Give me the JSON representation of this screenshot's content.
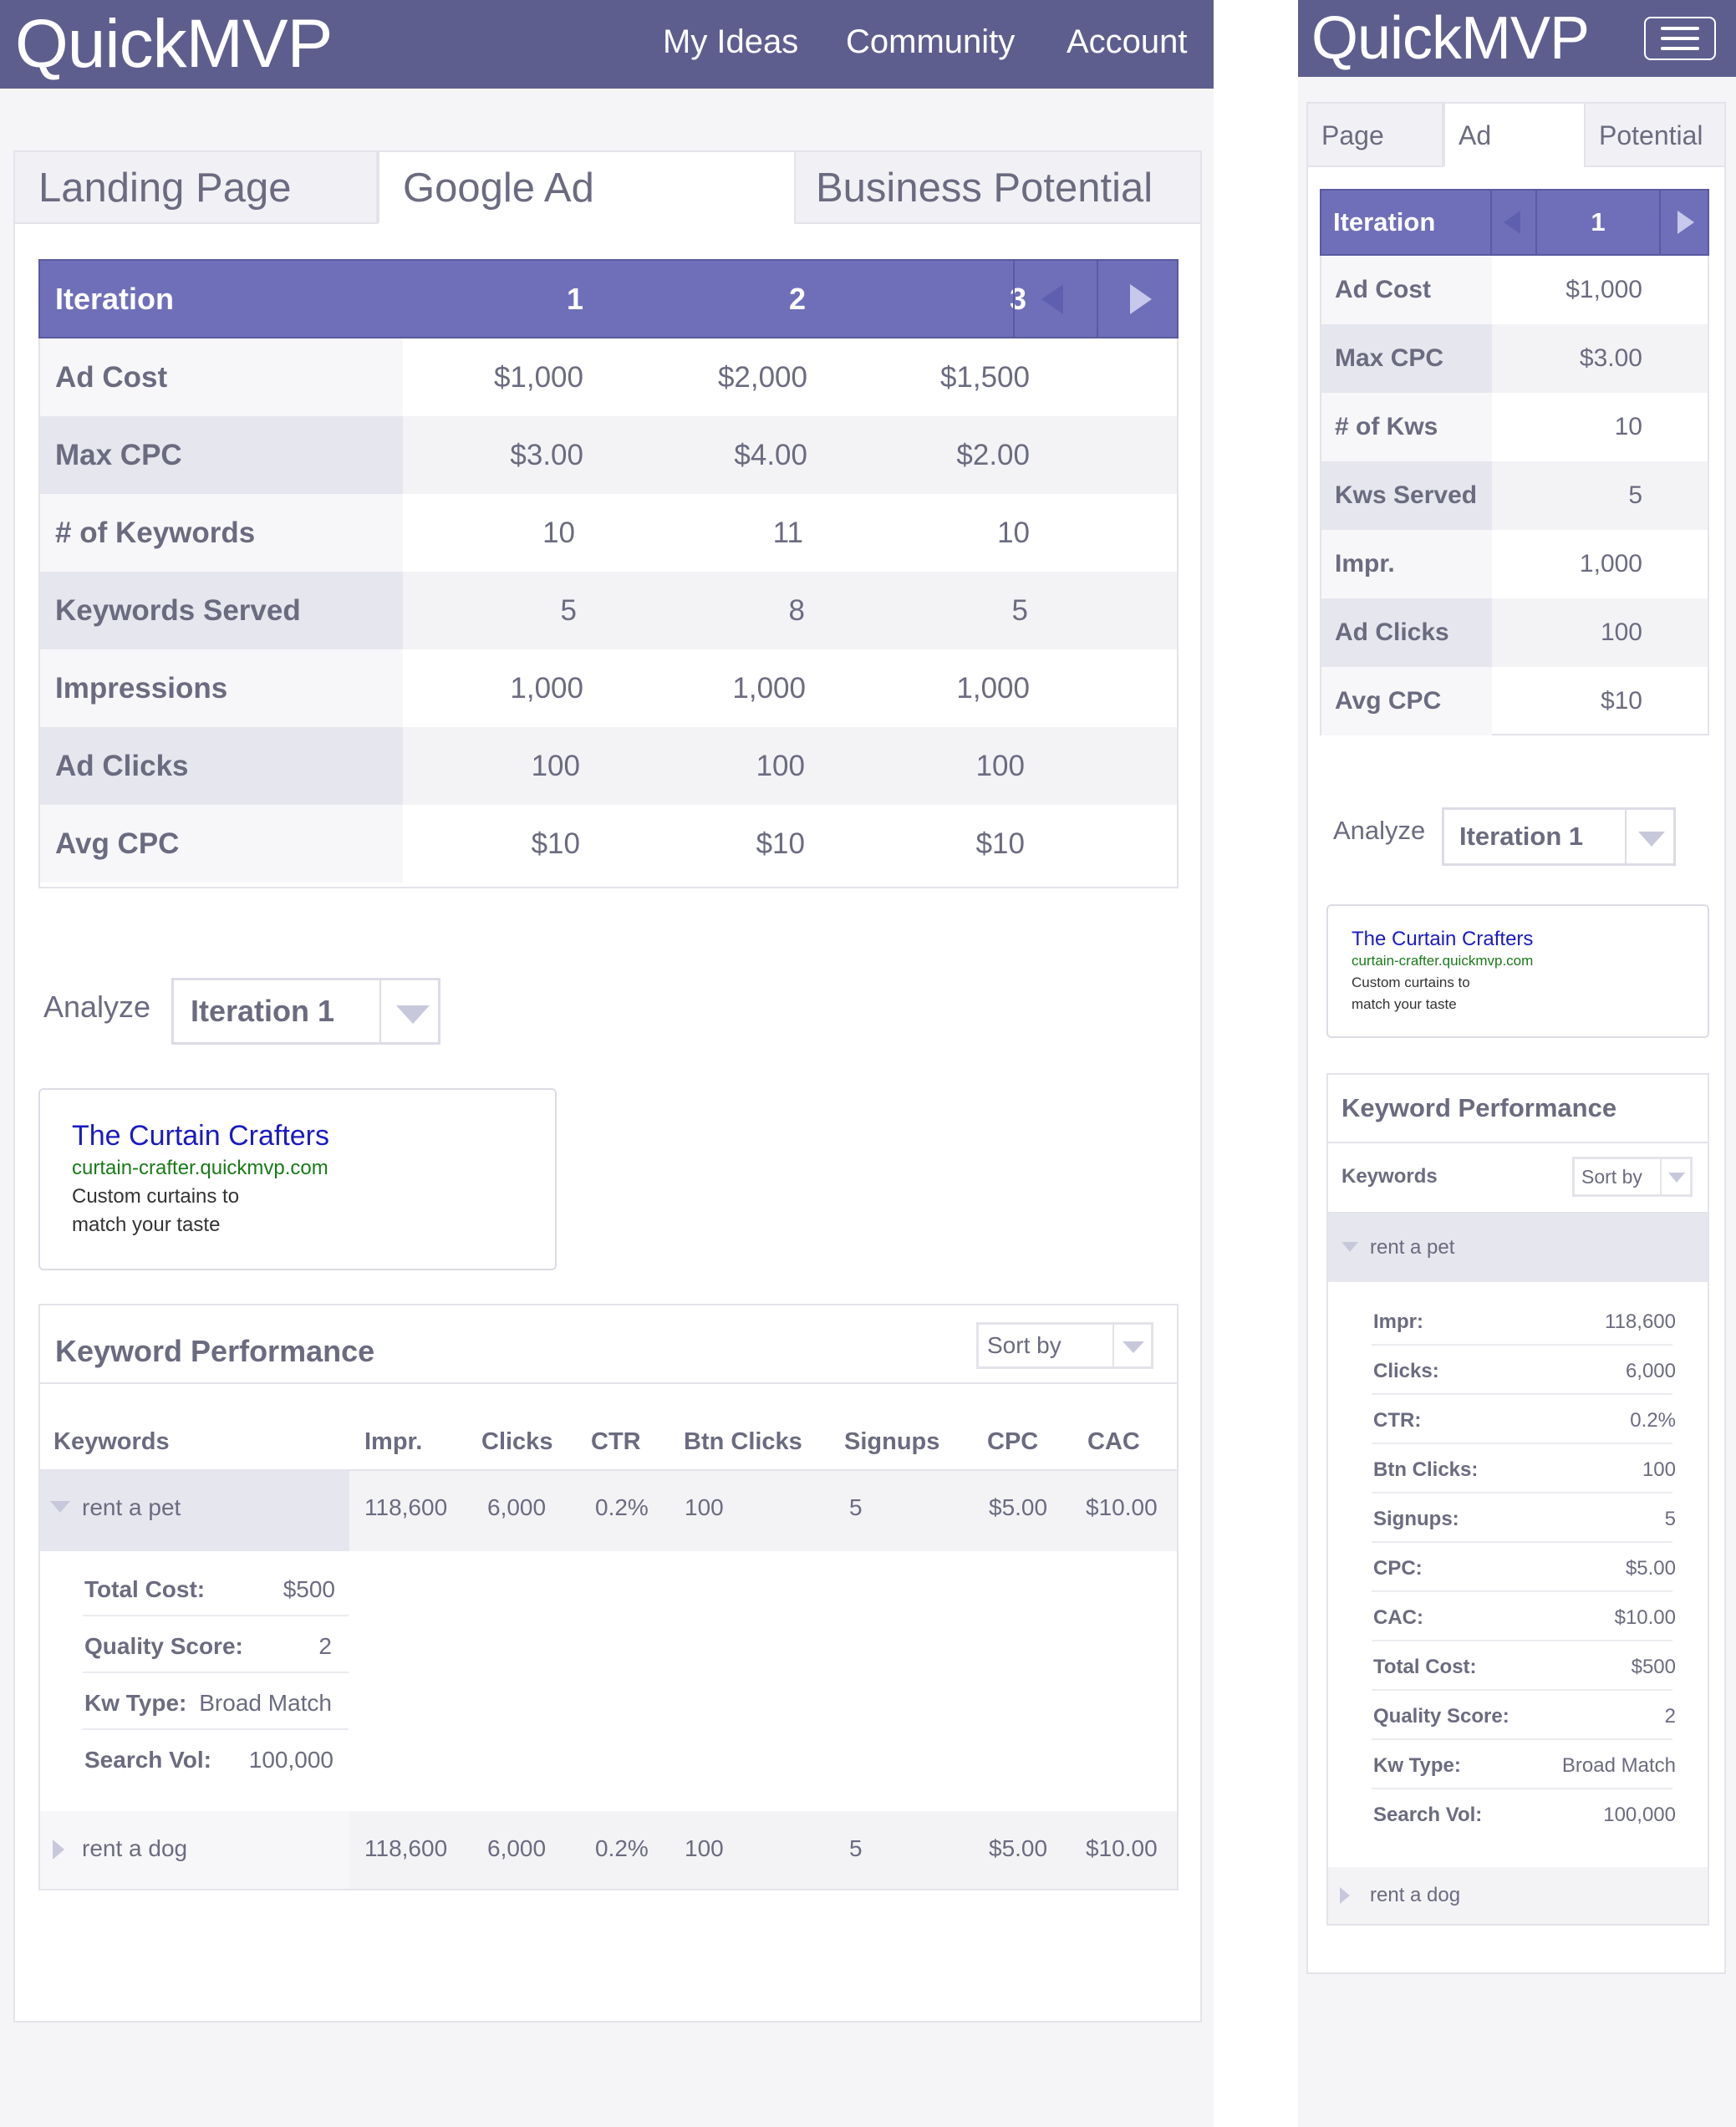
{
  "brand": "QuickMVP",
  "nav": [
    "My Ideas",
    "Community",
    "Account"
  ],
  "colors": {
    "header": "#5e5e8e",
    "table_header": "#6f6fb9",
    "ad_title": "#1b1bbf",
    "ad_url": "#1a7a1a"
  },
  "desktop": {
    "tabs": [
      "Landing Page",
      "Google Ad",
      "Business Potential"
    ],
    "active_tab": "Google Ad",
    "iteration": {
      "header_label": "Iteration",
      "columns": [
        "1",
        "2",
        "3"
      ],
      "rows": [
        {
          "label": "Ad Cost",
          "values": [
            "$1,000",
            "$2,000",
            "$1,500"
          ]
        },
        {
          "label": "Max CPC",
          "values": [
            "$3.00",
            "$4.00",
            "$2.00"
          ]
        },
        {
          "label": "# of Keywords",
          "values": [
            "10",
            "11",
            "10"
          ]
        },
        {
          "label": "Keywords Served",
          "values": [
            "5",
            "8",
            "5"
          ]
        },
        {
          "label": "Impressions",
          "values": [
            "1,000",
            "1,000",
            "1,000"
          ]
        },
        {
          "label": "Ad Clicks",
          "values": [
            "100",
            "100",
            "100"
          ]
        },
        {
          "label": "Avg CPC",
          "values": [
            "$10",
            "$10",
            "$10"
          ]
        }
      ]
    },
    "analyze": {
      "label": "Analyze",
      "selected": "Iteration 1"
    },
    "ad": {
      "title": "The Curtain Crafters",
      "url": "curtain-crafter.quickmvp.com",
      "desc_line1": "Custom curtains to",
      "desc_line2": "match your taste"
    },
    "keyword_performance": {
      "title": "Keyword Performance",
      "sort_label": "Sort by",
      "columns": [
        "Keywords",
        "Impr.",
        "Clicks",
        "CTR",
        "Btn Clicks",
        "Signups",
        "CPC",
        "CAC"
      ],
      "rows": [
        {
          "keyword": "rent a pet",
          "values": [
            "118,600",
            "6,000",
            "0.2%",
            "100",
            "5",
            "$5.00",
            "$10.00"
          ],
          "expanded": true
        },
        {
          "keyword": "rent a dog",
          "values": [
            "118,600",
            "6,000",
            "0.2%",
            "100",
            "5",
            "$5.00",
            "$10.00"
          ],
          "expanded": false
        }
      ],
      "details": [
        {
          "label": "Total Cost:",
          "value": "$500"
        },
        {
          "label": "Quality Score:",
          "value": "2"
        },
        {
          "label": "Kw Type:",
          "value": "Broad Match"
        },
        {
          "label": "Search Vol:",
          "value": "100,000"
        }
      ]
    }
  },
  "mobile": {
    "tabs": [
      "Page",
      "Ad",
      "Potential"
    ],
    "active_tab": "Ad",
    "iteration": {
      "header_label": "Iteration",
      "current": "1",
      "rows": [
        {
          "label": "Ad Cost",
          "value": "$1,000"
        },
        {
          "label": "Max CPC",
          "value": "$3.00"
        },
        {
          "label": "# of Kws",
          "value": "10"
        },
        {
          "label": "Kws Served",
          "value": "5"
        },
        {
          "label": "Impr.",
          "value": "1,000"
        },
        {
          "label": "Ad Clicks",
          "value": "100"
        },
        {
          "label": "Avg CPC",
          "value": "$10"
        }
      ]
    },
    "analyze": {
      "label": "Analyze",
      "selected": "Iteration 1"
    },
    "ad": {
      "title": "The Curtain Crafters",
      "url": "curtain-crafter.quickmvp.com",
      "desc_line1": "Custom curtains to",
      "desc_line2": "match your taste"
    },
    "keyword_performance": {
      "title": "Keyword Performance",
      "keywords_label": "Keywords",
      "sort_label": "Sort by",
      "expanded_keyword": "rent a pet",
      "details": [
        {
          "label": "Impr:",
          "value": "118,600"
        },
        {
          "label": "Clicks:",
          "value": "6,000"
        },
        {
          "label": "CTR:",
          "value": "0.2%"
        },
        {
          "label": "Btn Clicks:",
          "value": "100"
        },
        {
          "label": "Signups:",
          "value": "5"
        },
        {
          "label": "CPC:",
          "value": "$5.00"
        },
        {
          "label": "CAC:",
          "value": "$10.00"
        },
        {
          "label": "Total Cost:",
          "value": "$500"
        },
        {
          "label": "Quality Score:",
          "value": "2"
        },
        {
          "label": "Kw Type:",
          "value": "Broad Match"
        },
        {
          "label": "Search Vol:",
          "value": "100,000"
        }
      ],
      "collapsed_keyword": "rent a dog"
    }
  }
}
